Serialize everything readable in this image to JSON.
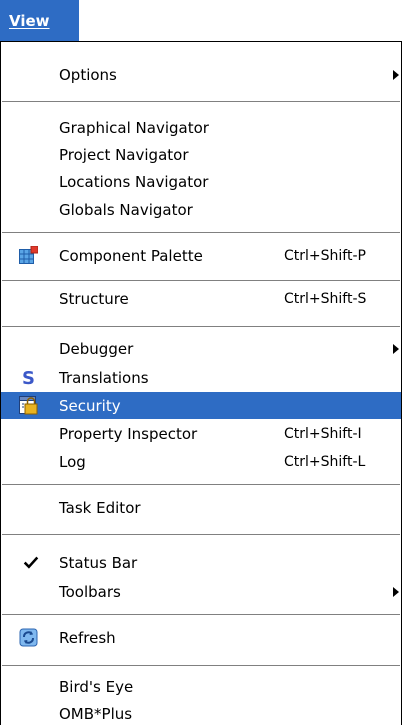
{
  "menubar": {
    "view_label": "View"
  },
  "menu": {
    "options": "Options",
    "graphical_navigator": "Graphical Navigator",
    "project_navigator": "Project Navigator",
    "locations_navigator": "Locations Navigator",
    "globals_navigator": "Globals Navigator",
    "component_palette": "Component Palette",
    "component_palette_shortcut": "Ctrl+Shift-P",
    "structure": "Structure",
    "structure_shortcut": "Ctrl+Shift-S",
    "debugger": "Debugger",
    "translations": "Translations",
    "security": "Security",
    "property_inspector": "Property Inspector",
    "property_inspector_shortcut": "Ctrl+Shift-I",
    "log": "Log",
    "log_shortcut": "Ctrl+Shift-L",
    "task_editor": "Task Editor",
    "status_bar": "Status Bar",
    "toolbars": "Toolbars",
    "refresh": "Refresh",
    "birds_eye": "Bird's Eye",
    "omb_plus": "OMB*Plus"
  },
  "state": {
    "highlighted_item": "Security",
    "checked_item": "Status Bar"
  },
  "colors": {
    "highlight": "#2e6cc4",
    "separator": "#808080"
  },
  "icons": {
    "component_palette": "component-palette-icon",
    "translations": "translations-icon",
    "security": "security-icon",
    "status_bar_check": "checkmark-icon",
    "refresh": "refresh-icon"
  }
}
